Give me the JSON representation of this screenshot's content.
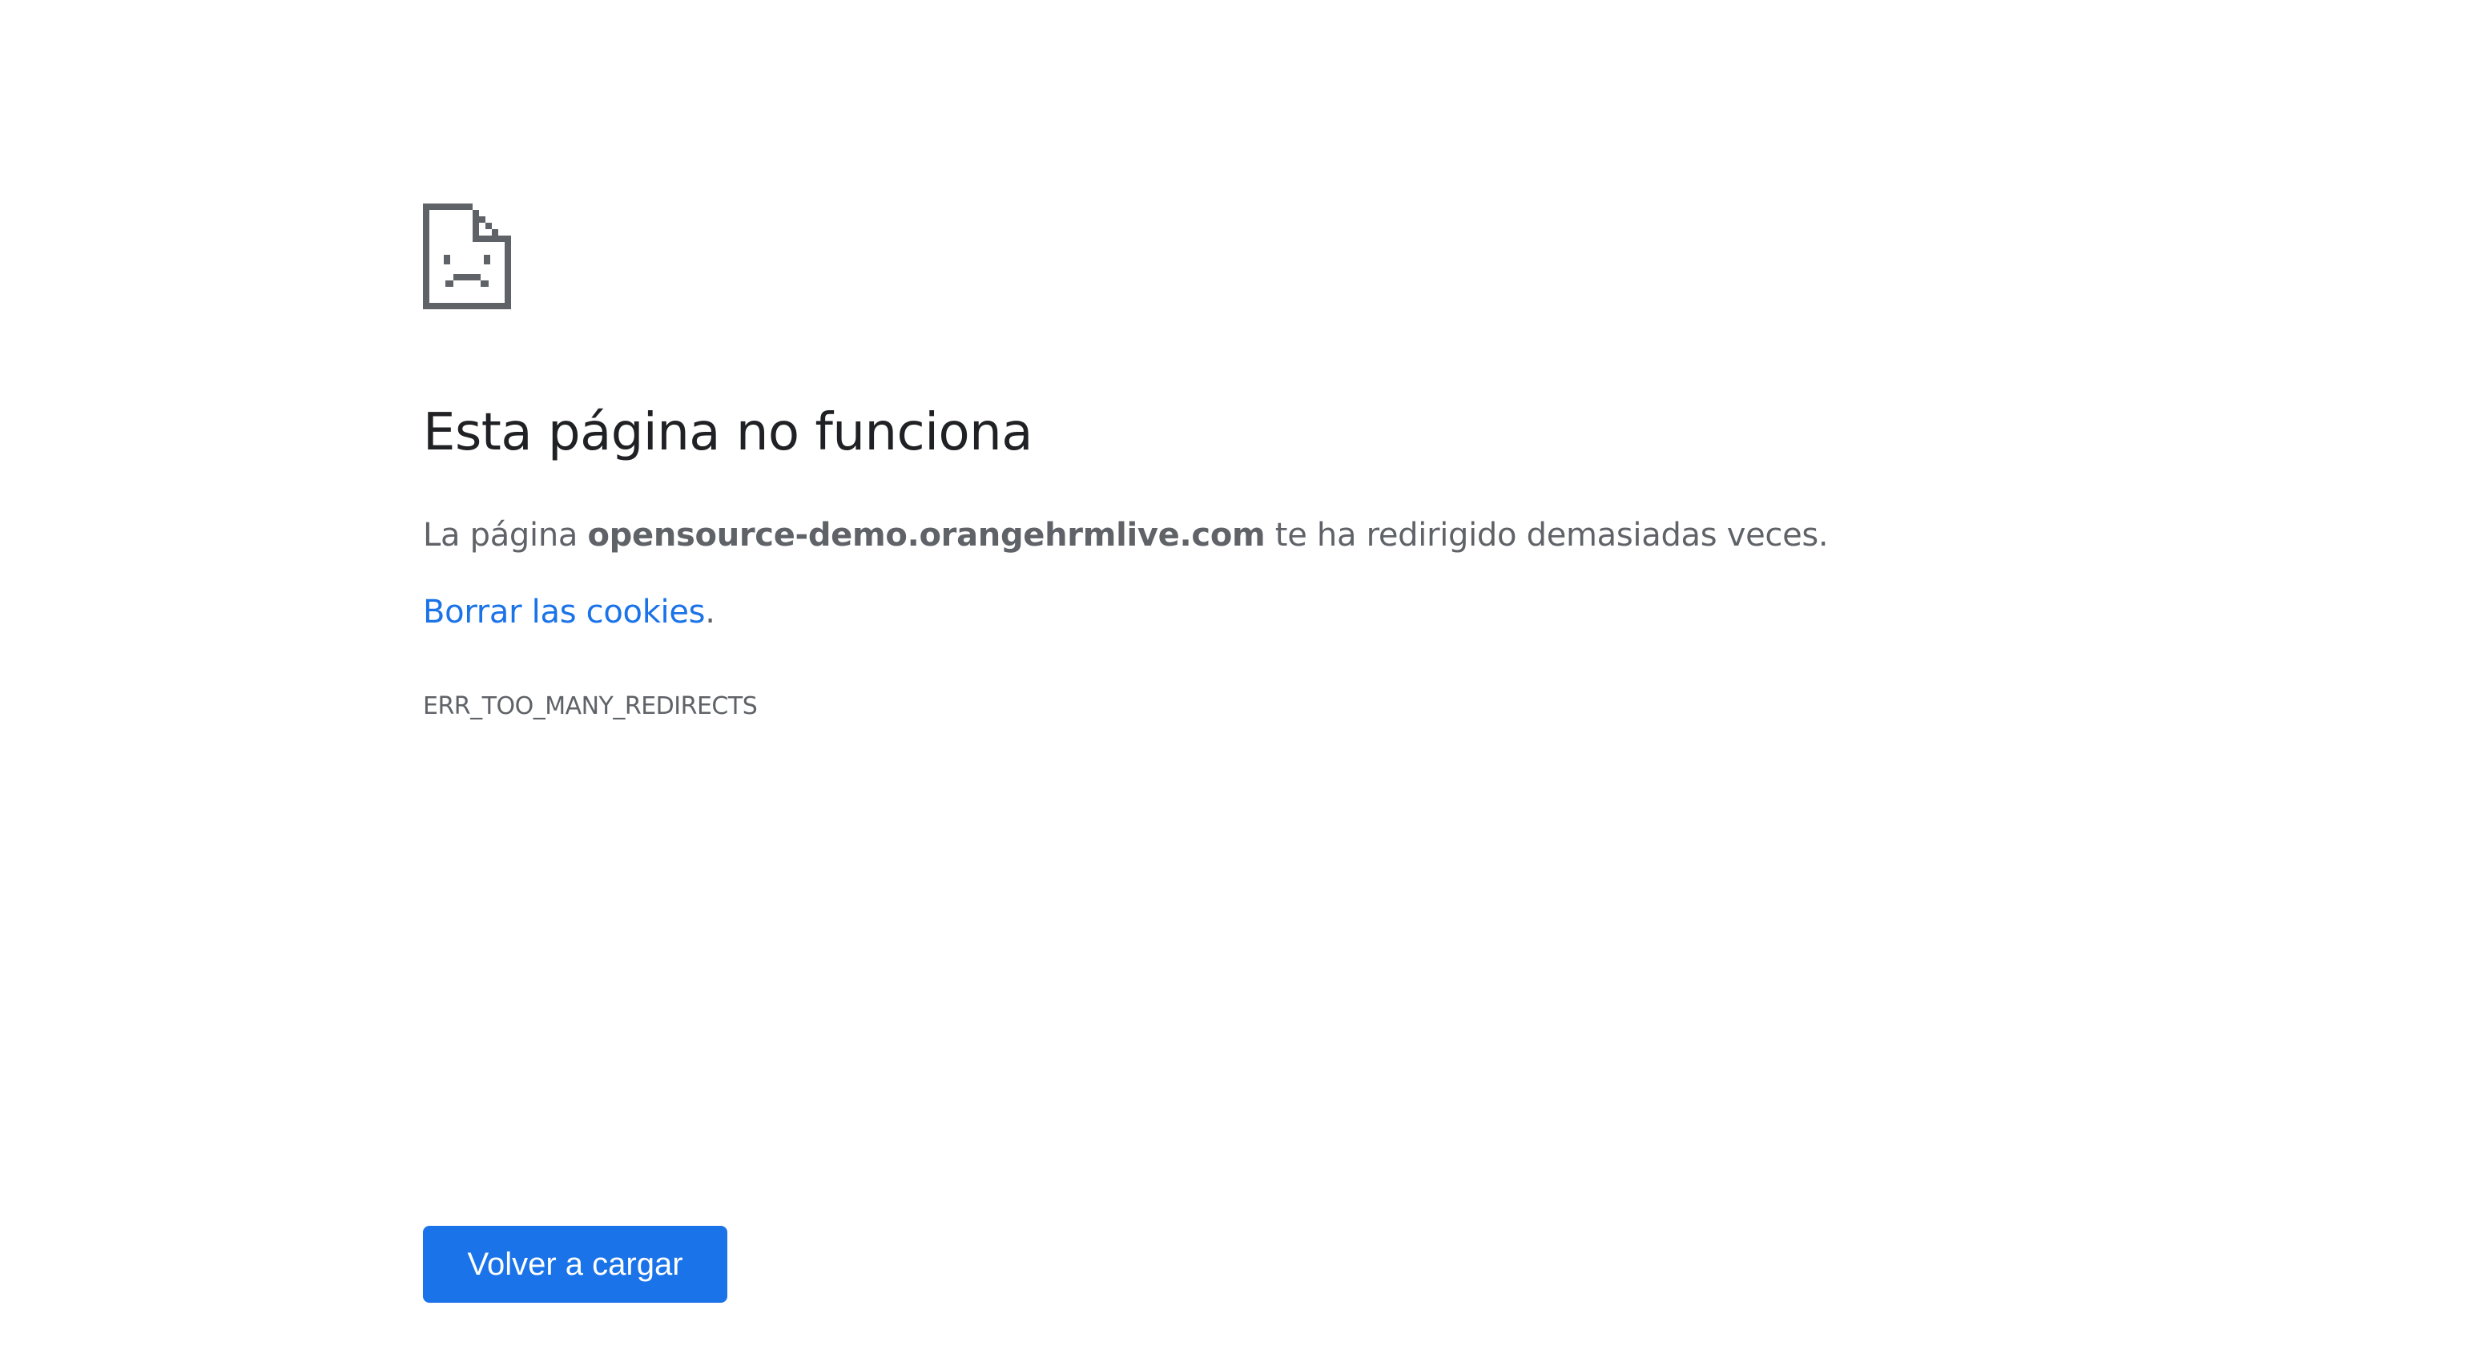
{
  "icon": {
    "name": "sad-page-icon"
  },
  "heading": "Esta página no funciona",
  "summary": {
    "prefix": "La página ",
    "host": "opensource-demo.orangehrmlive.com",
    "suffix": " te ha redirigido demasiadas veces."
  },
  "suggestion": {
    "link_label": "Borrar las cookies",
    "trailing": "."
  },
  "error_code": "ERR_TOO_MANY_REDIRECTS",
  "reload_button": {
    "label": "Volver a cargar"
  },
  "colors": {
    "heading": "#202124",
    "body_text": "#5f6368",
    "link": "#1a73e8",
    "button_bg": "#1a73e8",
    "icon": "#5f6368"
  }
}
